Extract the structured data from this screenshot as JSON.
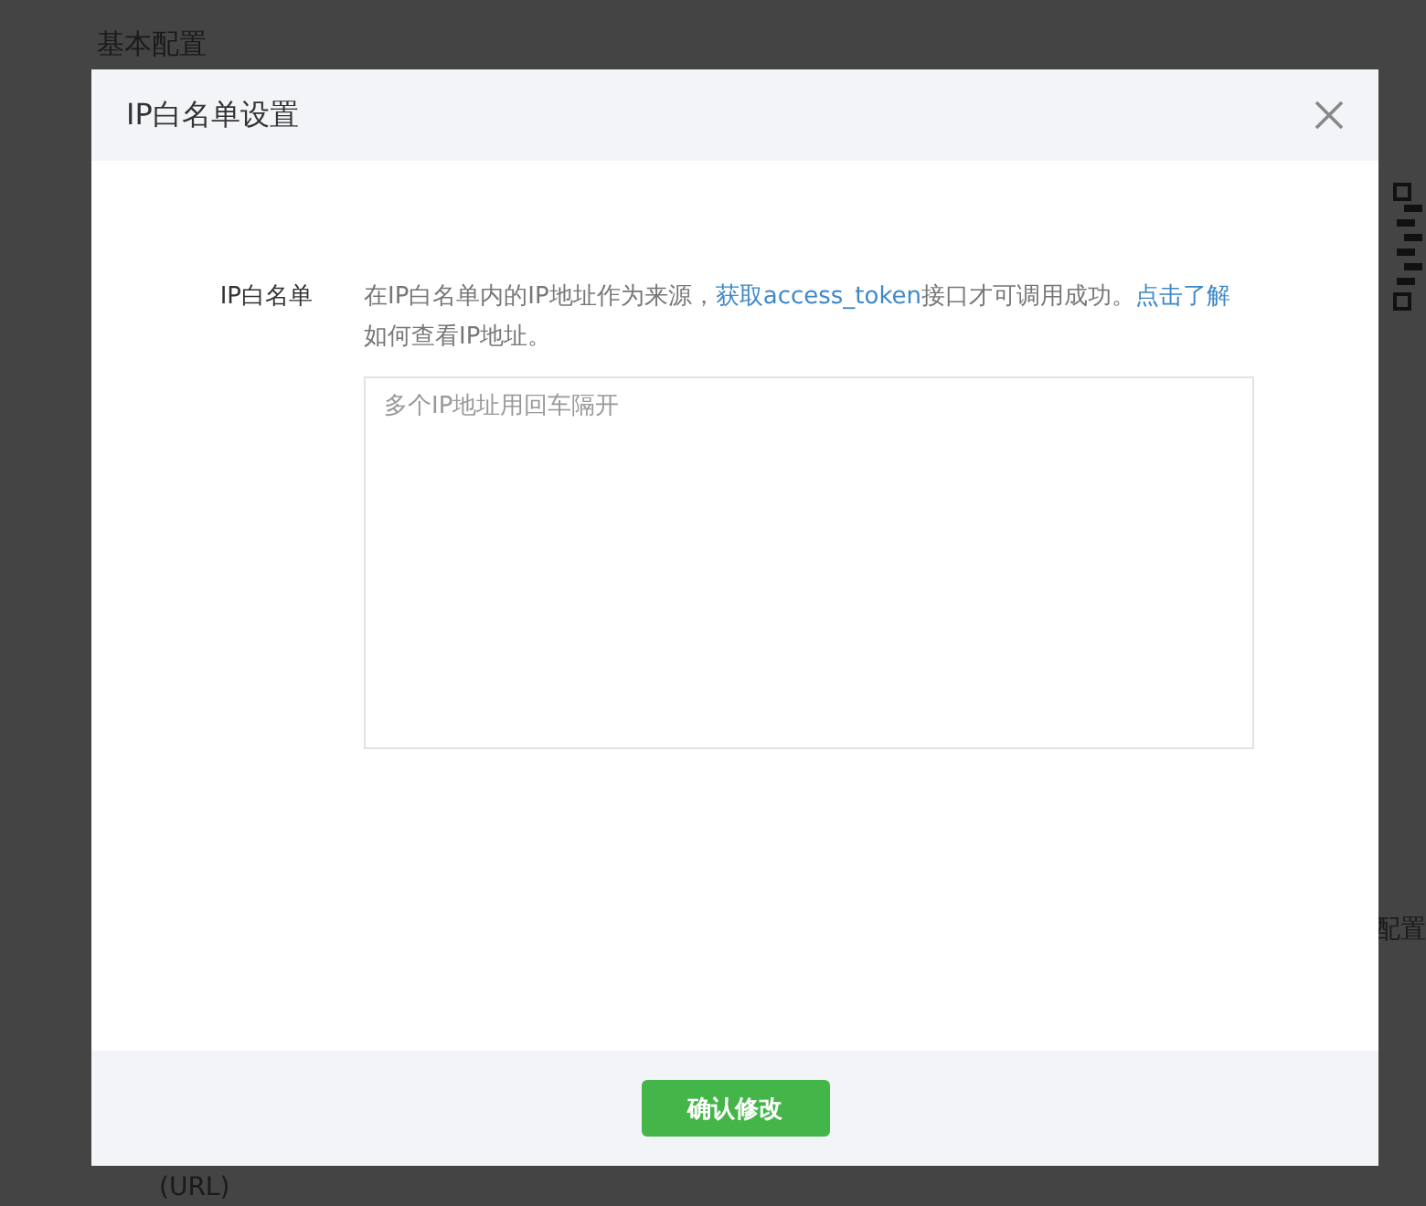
{
  "background": {
    "section_title": "基本配置",
    "side_label": "配置",
    "url_label": "(URL)"
  },
  "dialog": {
    "title": "IP白名单设置",
    "field_label": "IP白名单",
    "help": [
      {
        "text": "在IP白名单内的IP地址作为来源，",
        "link": false
      },
      {
        "text": "获取access_token",
        "link": true
      },
      {
        "text": "接口才可调用成功。",
        "link": false
      },
      {
        "text": "点击了解",
        "link": true
      },
      {
        "text": "如何查看IP地址。",
        "link": false
      }
    ],
    "textarea": {
      "placeholder": "多个IP地址用回车隔开"
    },
    "confirm_button": "确认修改"
  }
}
